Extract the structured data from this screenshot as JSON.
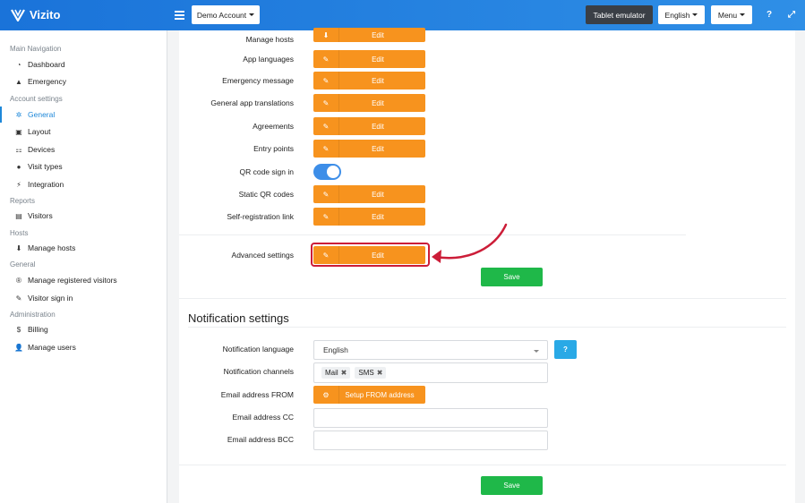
{
  "app": {
    "brand": "Vizito"
  },
  "topbar": {
    "account_label": "Demo Account",
    "tablet_label": "Tablet emulator",
    "language_label": "English",
    "menu_label": "Menu",
    "help_icon": "?",
    "expand_icon": "⤢"
  },
  "sidebar": {
    "sections": {
      "main": "Main Navigation",
      "account": "Account settings",
      "reports": "Reports",
      "hosts": "Hosts",
      "general": "General",
      "admin": "Administration"
    },
    "items": {
      "dashboard": {
        "label": "Dashboard",
        "icon": "dashboard-icon"
      },
      "emergency": {
        "label": "Emergency",
        "icon": "warning-icon"
      },
      "general": {
        "label": "General",
        "icon": "gear-icon"
      },
      "layout": {
        "label": "Layout",
        "icon": "image-icon"
      },
      "devices": {
        "label": "Devices",
        "icon": "sitemap-icon"
      },
      "visit_types": {
        "label": "Visit types",
        "icon": "users-icon"
      },
      "integration": {
        "label": "Integration",
        "icon": "plug-icon"
      },
      "visitors": {
        "label": "Visitors",
        "icon": "book-icon"
      },
      "manage_hosts": {
        "label": "Manage hosts",
        "icon": "download-icon"
      },
      "registered": {
        "label": "Manage registered visitors",
        "icon": "registered-icon"
      },
      "signin": {
        "label": "Visitor sign in",
        "icon": "pencil-icon"
      },
      "billing": {
        "label": "Billing",
        "icon": "dollar-icon"
      },
      "users": {
        "label": "Manage users",
        "icon": "user-plus-icon"
      }
    }
  },
  "settings": {
    "edit_label": "Edit",
    "rows": {
      "manage_hosts": "Manage hosts",
      "app_languages": "App languages",
      "emergency_message": "Emergency message",
      "general_translations": "General app translations",
      "agreements": "Agreements",
      "entry_points": "Entry points",
      "qr_signin": "QR code sign in",
      "static_qr": "Static QR codes",
      "self_registration": "Self-registration link",
      "advanced": "Advanced settings"
    },
    "qr_signin_enabled": true,
    "save_label": "Save"
  },
  "notifications": {
    "title": "Notification settings",
    "language_label": "Notification language",
    "language_value": "English",
    "help_label": "?",
    "channels_label": "Notification channels",
    "channels": [
      "Mail",
      "SMS"
    ],
    "email_from_label": "Email address FROM",
    "setup_from_label": "Setup FROM address",
    "email_cc_label": "Email address CC",
    "email_cc_value": "",
    "email_bcc_label": "Email address BCC",
    "email_bcc_value": "",
    "save_label": "Save"
  },
  "colors": {
    "topbar": "#1a73d9",
    "accent_orange": "#f7931e",
    "save_green": "#1fb849",
    "highlight_red": "#cc1d38",
    "help_blue": "#29a9e6"
  }
}
